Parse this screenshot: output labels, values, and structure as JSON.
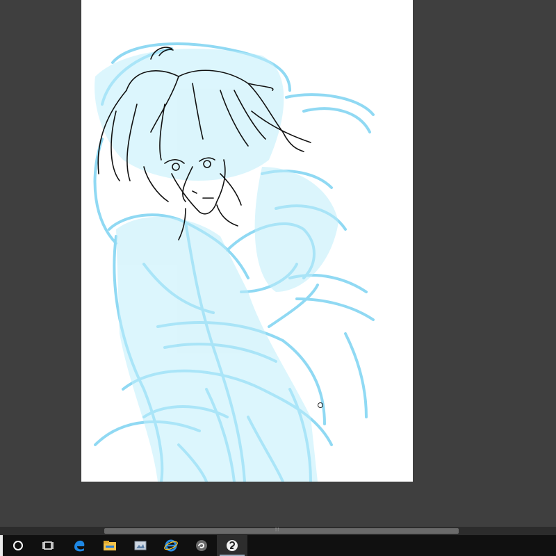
{
  "app": {
    "type": "drawing-application",
    "canvas_background": "#ffffff",
    "workspace_background": "#3f3f3f"
  },
  "sketch": {
    "line_layer_color": "#111111",
    "rough_layer_color": "#7dd3f2"
  },
  "scrollbar": {
    "grip_glyph": "⦙⦙⦙"
  },
  "taskbar": {
    "background": "#101010",
    "items": [
      {
        "icon": "cortana-search-icon"
      },
      {
        "icon": "task-view-icon"
      },
      {
        "icon": "edge-browser-icon"
      },
      {
        "icon": "file-explorer-icon"
      },
      {
        "icon": "photos-app-icon"
      },
      {
        "icon": "internet-explorer-icon"
      },
      {
        "icon": "snipping-swirl-app-icon"
      },
      {
        "icon": "clip-studio-paint-icon",
        "active": true
      }
    ]
  }
}
